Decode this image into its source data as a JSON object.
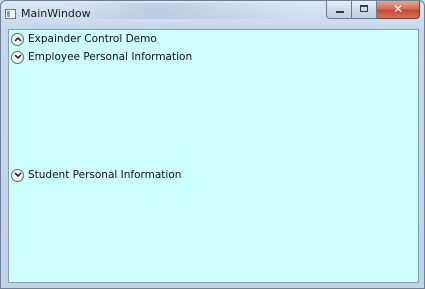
{
  "window": {
    "title": "MainWindow",
    "close_glyph": "✕"
  },
  "expanders": [
    {
      "label": "Expainder Control Demo",
      "state": "expanded",
      "icon": "chevron-up-icon"
    },
    {
      "label": "Employee Personal Information",
      "state": "collapsed",
      "icon": "chevron-down-icon"
    },
    {
      "label": "Student Personal Information",
      "state": "collapsed",
      "icon": "chevron-down-icon"
    }
  ],
  "colors": {
    "client_background": "#ccfeff",
    "frame": "#c4d7ee",
    "close_button": "#c94e33"
  }
}
